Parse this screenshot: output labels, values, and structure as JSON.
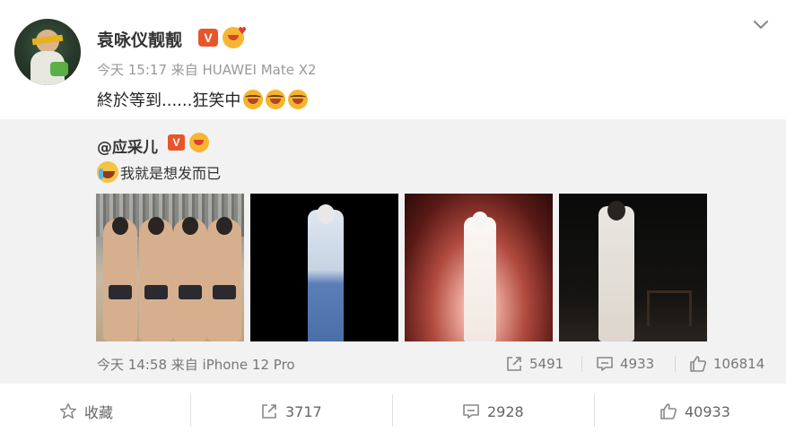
{
  "post": {
    "author": "袁咏仪靓靓",
    "verified_badge": "V",
    "time_source": "今天 15:17 来自 HUAWEI Mate X2",
    "text": "終於等到......狂笑中"
  },
  "repost": {
    "original_author": "@应采儿",
    "verified_badge": "V",
    "text": "我就是想发而已",
    "time_source": "今天 14:58 来自 iPhone 12 Pro",
    "stats": {
      "reposts": "5491",
      "comments": "4933",
      "likes": "106814"
    }
  },
  "actions": {
    "favorite": "收藏",
    "repost": "3717",
    "comment": "2928",
    "like": "40933"
  },
  "colors": {
    "verified_orange": "#e8552a",
    "repost_background": "#f2f2f2",
    "meta_gray": "#999999"
  },
  "icons": [
    "chevron-down-icon",
    "laugh-emoji",
    "cry-laugh-emoji",
    "repost-icon",
    "comment-icon",
    "like-icon",
    "star-icon"
  ]
}
